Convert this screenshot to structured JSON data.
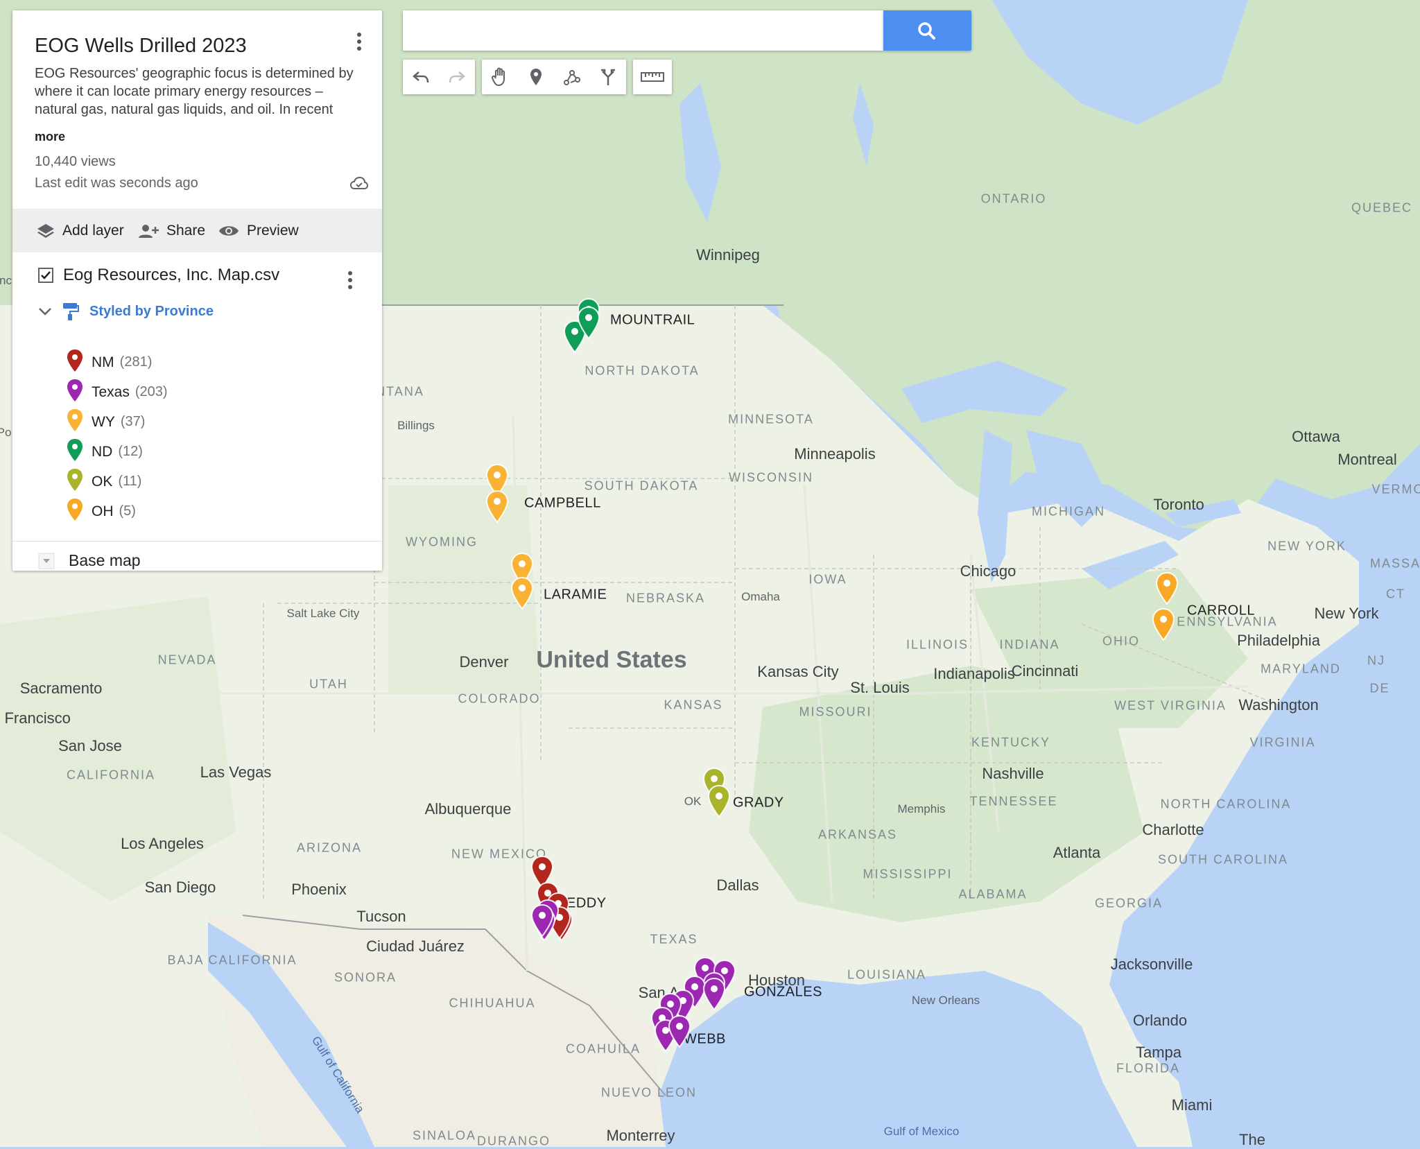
{
  "panel": {
    "title": "EOG Wells Drilled 2023",
    "description": "EOG Resources' geographic focus is determined by where it can locate primary energy resources – natural gas, natural gas liquids, and oil. In recent",
    "more": "more",
    "views": "10,440 views",
    "last_edit": "Last edit was seconds ago",
    "actions": {
      "add_layer": "Add layer",
      "share": "Share",
      "preview": "Preview"
    },
    "layer": {
      "name": "Eog Resources, Inc. Map.csv",
      "styled_by": "Styled by Province",
      "legend": [
        {
          "name": "NM",
          "count": "(281)",
          "color": "#b3261e"
        },
        {
          "name": "Texas",
          "count": "(203)",
          "color": "#9c27b0"
        },
        {
          "name": "WY",
          "count": "(37)",
          "color": "#f9b233"
        },
        {
          "name": "ND",
          "count": "(12)",
          "color": "#0f9d58"
        },
        {
          "name": "OK",
          "count": "(11)",
          "color": "#a9b42a"
        },
        {
          "name": "OH",
          "count": "(5)",
          "color": "#f9a825"
        }
      ]
    },
    "base_map": "Base map"
  },
  "search": {
    "placeholder": ""
  },
  "map": {
    "country": "United States",
    "states": [
      "NORTH DAKOTA",
      "SOUTH DAKOTA",
      "MINNESOTA",
      "WISCONSIN",
      "MICHIGAN",
      "WYOMING",
      "NEBRASKA",
      "IOWA",
      "ILLINOIS",
      "INDIANA",
      "OHIO",
      "PENNSYLVANIA",
      "NEW YORK",
      "NEVADA",
      "UTAH",
      "COLORADO",
      "KANSAS",
      "MISSOURI",
      "KENTUCKY",
      "WEST VIRGINIA",
      "VIRGINIA",
      "MARYLAND",
      "CALIFORNIA",
      "ARIZONA",
      "NEW MEXICO",
      "TEXAS",
      "ARKANSAS",
      "TENNESSEE",
      "NORTH CAROLINA",
      "SOUTH CAROLINA",
      "MISSISSIPPI",
      "ALABAMA",
      "GEORGIA",
      "LOUISIANA",
      "FLORIDA",
      "ONTARIO",
      "QUEBEC",
      "NTANA",
      "BAJA CALIFORNIA",
      "SONORA",
      "CHIHUAHUA",
      "COAHUILA",
      "NUEVO LEON",
      "SINALOA",
      "DURANGO",
      "VERMON",
      "MASSAC",
      "NJ",
      "DE",
      "CT"
    ],
    "cities": [
      "Winnipeg",
      "Billings",
      "Minneapolis",
      "Ottawa",
      "Montreal",
      "Toronto",
      "Chicago",
      "Omaha",
      "Salt Lake City",
      "Denver",
      "Kansas City",
      "St. Louis",
      "Indianapolis",
      "Cincinnati",
      "Philadelphia",
      "New York",
      "Washington",
      "Sacramento",
      "n Francisco",
      "San Jose",
      "Las Vegas",
      "Albuquerque",
      "Los Angeles",
      "San Diego",
      "Phoenix",
      "Tucson",
      "Ciudad Juárez",
      "Dallas",
      "Memphis",
      "Nashville",
      "Charlotte",
      "Atlanta",
      "Houston",
      "San A",
      "New Orleans",
      "Jacksonville",
      "Orlando",
      "Tampa",
      "Miami",
      "Monterrey",
      "The",
      "Po",
      "nc",
      "OK"
    ],
    "water": [
      "Gulf of California",
      "Gulf of Mexico"
    ],
    "counties": [
      "MOUNTRAIL",
      "CAMPBELL",
      "LARAMIE",
      "CARROLL",
      "GRADY",
      "EDDY",
      "GONZALES",
      "WEBB"
    ]
  }
}
